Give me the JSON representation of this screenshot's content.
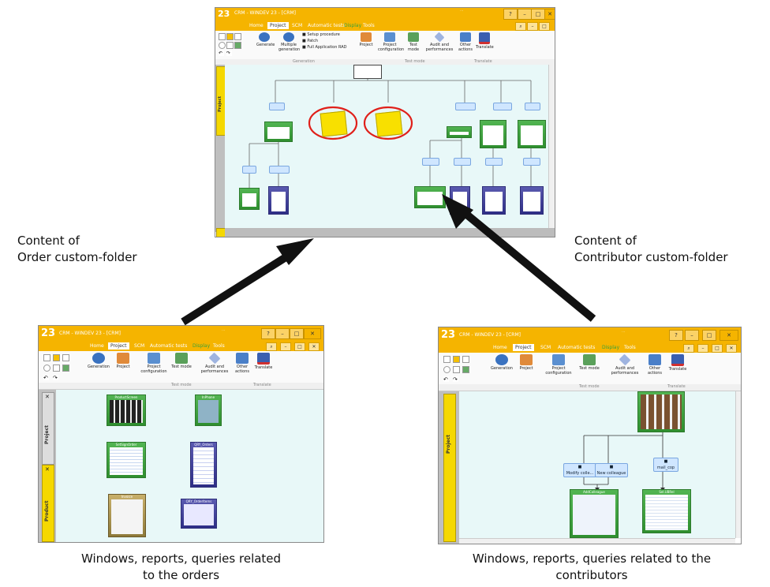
{
  "captions": {
    "order_label": [
      "Content of",
      "Order custom-folder"
    ],
    "contributor_label": [
      "Content of",
      "Contributor custom-folder"
    ],
    "bottom_left": [
      "Windows, reports, queries related",
      "to the orders"
    ],
    "bottom_right": [
      "Windows, reports, queries related to the",
      "contributors"
    ]
  },
  "window": {
    "title": "CRM - WINDEV 23 - [CRM]",
    "menu": [
      "Home",
      "Project",
      "SCM",
      "Automatic tests",
      "Display",
      "Tools"
    ],
    "active_menu": "Project",
    "ribbon_top": {
      "buttons": [
        "Generate",
        "Multiple generation",
        "Project",
        "Project configuration",
        "Test mode",
        "Audit and performances",
        "Other actions",
        "Translate"
      ],
      "small_actions": [
        "Setup procedure",
        "Patch",
        "Full Application RAD"
      ],
      "groups": [
        "Generation",
        "Test mode",
        "Translate"
      ]
    },
    "ribbon_bottom": {
      "buttons": [
        "Generation",
        "Project",
        "Project configuration",
        "Test mode",
        "Audit and performances",
        "Other actions",
        "Translate"
      ],
      "groups": [
        "Test mode",
        "Translate"
      ]
    },
    "side_tab": "Project"
  },
  "order_folder": {
    "items": [
      "ProductScreen",
      "InPhone",
      "SetSignOrder",
      "QRY_Orders",
      "Invoice",
      "QRY_OrderItems"
    ]
  },
  "contributor_folder": {
    "labels": [
      "Modify colle...",
      "New colleague",
      "mail_cop"
    ],
    "windows": [
      "AddColleague",
      "Sel.UBRel"
    ]
  },
  "colors": {
    "title_bar": "#f5b400",
    "arrow": "#111111",
    "canvas": "#e8f8f8",
    "window_node": "#3ea13e",
    "report_node": "#3b3b96",
    "circle": "#e0201a"
  }
}
